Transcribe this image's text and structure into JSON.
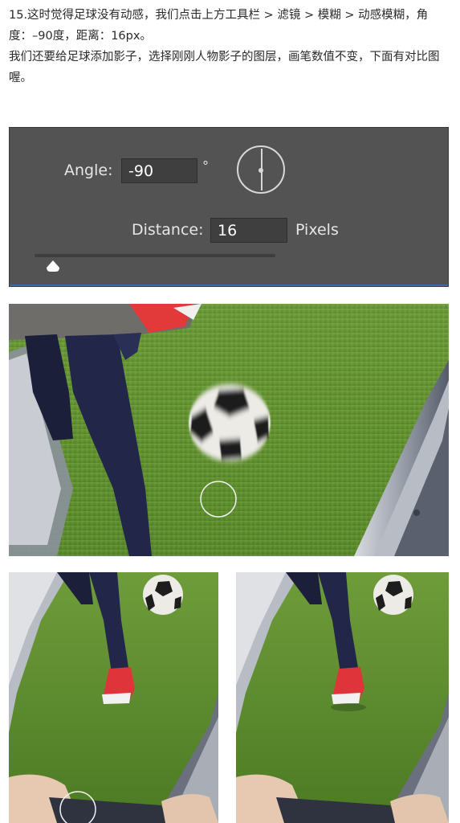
{
  "article": {
    "paragraphs": [
      "15.这时觉得足球没有动感，我们点击上方工具栏 > 滤镜 > 模糊 > 动感模糊，角度：–90度，距离：16px。",
      "我们还要给足球添加影子，选择刚刚人物影子的图层，画笔数值不变，下面有对比图喔。"
    ]
  },
  "dialog": {
    "angle_label": "Angle:",
    "angle_value": "-90",
    "degree_symbol": "°",
    "distance_label": "Distance:",
    "distance_value": "16",
    "unit_label": "Pixels",
    "slider_level": 0.07
  },
  "colors": {
    "panel": "#535353",
    "accent": "#3c6aa8",
    "grass": "#5a8a2e",
    "sneaker": "#e0343b"
  }
}
